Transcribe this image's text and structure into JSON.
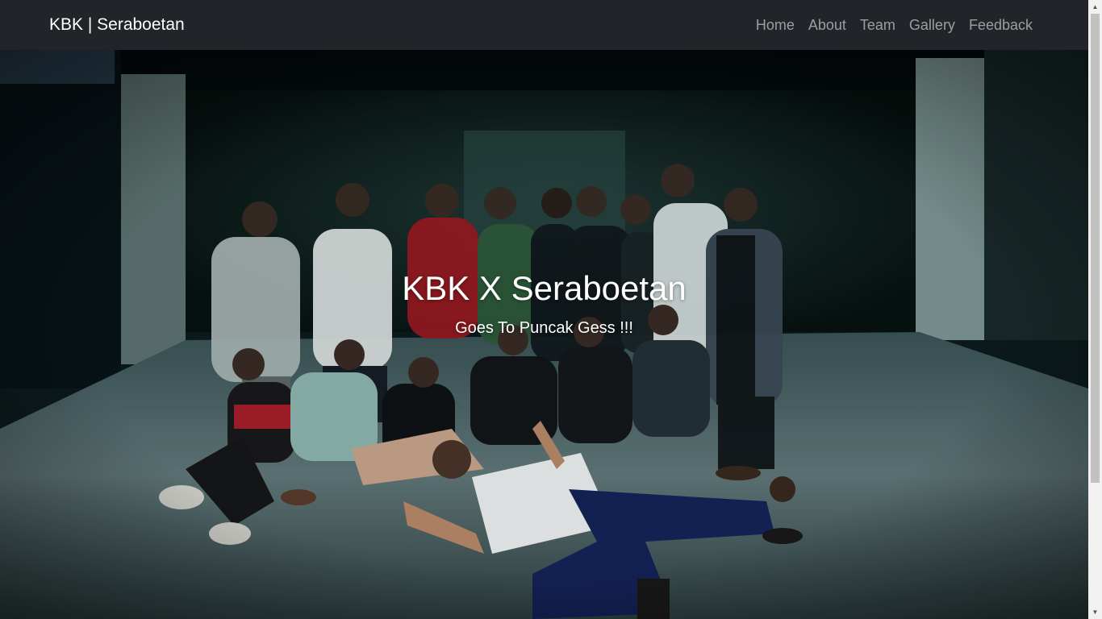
{
  "navbar": {
    "brand": "KBK | Seraboetan",
    "links": [
      {
        "label": "Home"
      },
      {
        "label": "About"
      },
      {
        "label": "Team"
      },
      {
        "label": "Gallery"
      },
      {
        "label": "Feedback"
      }
    ]
  },
  "hero": {
    "title": "KBK X Seraboetan",
    "subtitle": "Goes To Puncak Gess !!!",
    "background_image": "group-photo"
  },
  "colors": {
    "navbar_bg": "#212529",
    "brand_text": "#ffffff",
    "nav_link_text": "rgba(255,255,255,0.55)",
    "hero_text": "#ffffff"
  },
  "scrollbar": {
    "thumb_fraction": 0.76,
    "position_fraction": 0
  }
}
